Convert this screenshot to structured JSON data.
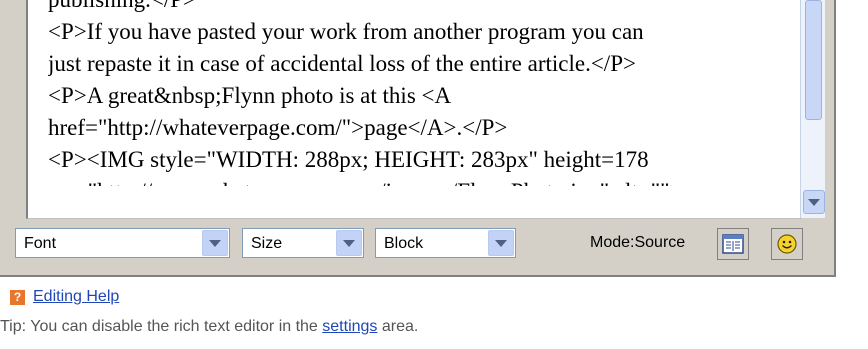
{
  "editor": {
    "lines": [
      "publishing.</P>",
      "<P>If you have pasted your work from another program you can",
      "just repaste it in case of accidental loss of the entire article.</P>",
      "<P>A great&nbsp;Flynn photo is at this <A",
      "href=\"http://whateverpage.com/\">page</A>.</P>",
      "<P><IMG style=\"WIDTH: 288px; HEIGHT: 283px\" height=178",
      "src=\"http://www.whateverpage.com/images/FlynnPhoto.jpg\" alt=\"\">"
    ]
  },
  "toolbar": {
    "font_select": "Font",
    "size_select": "Size",
    "block_select": "Block",
    "mode_label": "Mode:Source"
  },
  "icons": {
    "mode_toggle": "source-view-icon",
    "smiley": "smiley-icon",
    "help": "help-icon"
  },
  "footer": {
    "help_link": "Editing Help",
    "tip_prefix": "Tip: You can disable the rich text editor in the ",
    "tip_link": "settings",
    "tip_suffix": " area."
  }
}
